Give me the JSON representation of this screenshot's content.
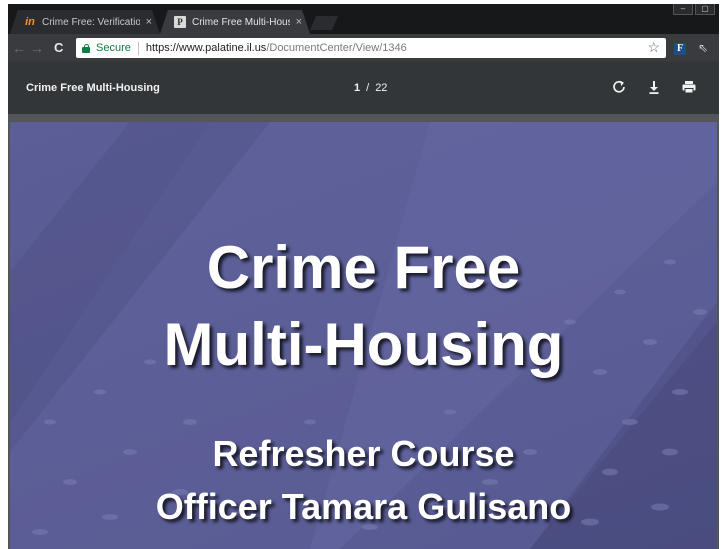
{
  "browser": {
    "tabs": [
      {
        "title": "Crime Free: Verification",
        "favicon": "in-icon",
        "active": false
      },
      {
        "title": "Crime Free Multi-Housin",
        "favicon": "p-icon",
        "active": true
      }
    ],
    "tab_close_glyph": "×"
  },
  "toolbar": {
    "secure_label": "Secure",
    "url_host": "https://www.palatine.il.us",
    "url_path": "/DocumentCenter/View/1346",
    "extension_label": "F"
  },
  "pdf": {
    "document_title": "Crime Free Multi-Housing",
    "current_page": "1",
    "page_separator": "/",
    "total_pages": "22"
  },
  "slide": {
    "title_line1": "Crime Free",
    "title_line2": "Multi-Housing",
    "subtitle": "Refresher Course",
    "presenter": "Officer Tamara Gulisano"
  },
  "colors": {
    "frame_dark": "#202124",
    "pdf_toolbar": "#323639",
    "slide_background": "#56588f",
    "secure_green": "#0b8043"
  }
}
